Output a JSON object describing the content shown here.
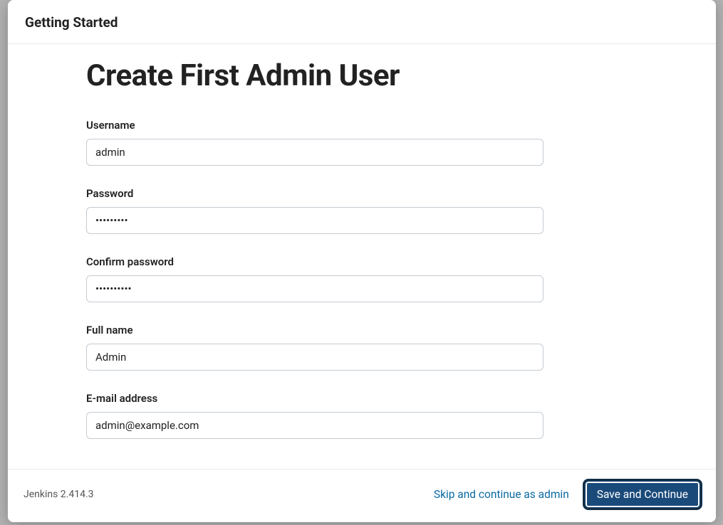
{
  "header": {
    "title": "Getting Started"
  },
  "page": {
    "title": "Create First Admin User"
  },
  "form": {
    "username": {
      "label": "Username",
      "value": "admin"
    },
    "password": {
      "label": "Password",
      "value": "•••••••••"
    },
    "confirm_password": {
      "label": "Confirm password",
      "value": "••••••••••"
    },
    "full_name": {
      "label": "Full name",
      "value": "Admin"
    },
    "email": {
      "label": "E-mail address",
      "value": "admin@example.com"
    }
  },
  "footer": {
    "version": "Jenkins 2.414.3",
    "skip_label": "Skip and continue as admin",
    "save_label": "Save and Continue"
  }
}
